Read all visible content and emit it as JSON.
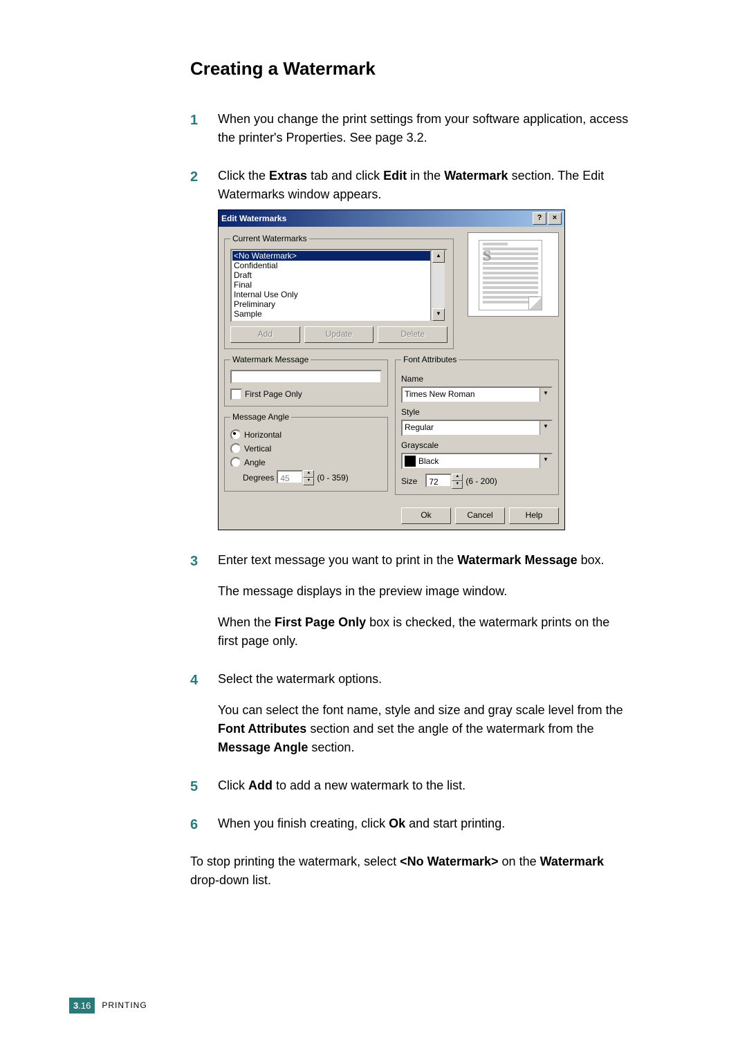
{
  "heading": "Creating a Watermark",
  "steps": {
    "s1": {
      "num": "1",
      "text": "When you change the print settings from your software application, access the printer's Properties. See page 3.2."
    },
    "s2": {
      "num": "2",
      "pre": "Click the ",
      "b1": "Extras",
      "mid1": " tab and click ",
      "b2": "Edit",
      "mid2": " in the ",
      "b3": "Watermark",
      "post": " section. The Edit Watermarks window appears."
    },
    "s3": {
      "num": "3",
      "pre": "Enter text message you want to print in the ",
      "b1": "Watermark Message",
      "post": " box.",
      "p2": "The message displays in the preview image window.",
      "p3a": "When the ",
      "p3b": "First Page Only",
      "p3c": " box is checked, the watermark prints on the first page only."
    },
    "s4": {
      "num": "4",
      "text": "Select the watermark options.",
      "p2a": "You can select the font name, style and size and gray scale level from the ",
      "p2b": "Font Attributes",
      "p2c": " section and set the angle of the watermark from the ",
      "p2d": "Message Angle",
      "p2e": " section."
    },
    "s5": {
      "num": "5",
      "pre": "Click ",
      "b1": "Add",
      "post": " to add a new watermark to the list."
    },
    "s6": {
      "num": "6",
      "pre": "When you finish creating, click ",
      "b1": "Ok",
      "post": " and start printing."
    }
  },
  "tail": {
    "a": "To stop printing the watermark, select ",
    "b": "<No Watermark>",
    "c": " on the ",
    "d": "Watermark",
    "e": " drop-down list."
  },
  "dialog": {
    "title": "Edit Watermarks",
    "help": "?",
    "close": "×",
    "group_current": "Current Watermarks",
    "list": [
      "<No Watermark>",
      "Confidential",
      "Draft",
      "Final",
      "Internal Use Only",
      "Preliminary",
      "Sample"
    ],
    "btns": {
      "add": "Add",
      "update": "Update",
      "delete": "Delete"
    },
    "preview_letter": "S",
    "group_msg": "Watermark Message",
    "first_page": "First Page Only",
    "group_angle": "Message Angle",
    "horiz": "Horizontal",
    "vert": "Vertical",
    "angle": "Angle",
    "degrees": "Degrees",
    "deg_val": "45",
    "deg_range": "(0 - 359)",
    "group_font": "Font Attributes",
    "name_lbl": "Name",
    "name_val": "Times New Roman",
    "style_lbl": "Style",
    "style_val": "Regular",
    "gray_lbl": "Grayscale",
    "gray_val": "Black",
    "size_lbl": "Size",
    "size_val": "72",
    "size_range": "(6 - 200)",
    "ok": "Ok",
    "cancel": "Cancel",
    "helpbtn": "Help"
  },
  "footer": {
    "chapter": "3",
    "page": ".16",
    "label": "PRINTING"
  }
}
